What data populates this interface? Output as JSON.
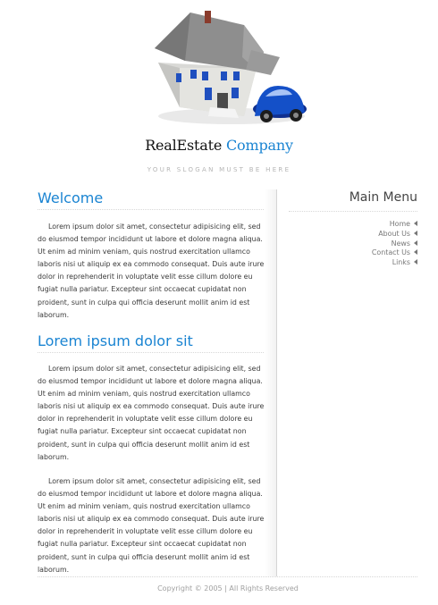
{
  "header": {
    "logo_part1": "RealEstate",
    "logo_part2": "Company",
    "slogan": "YOUR SLOGAN MUST BE HERE",
    "hero_image": "house-and-car-image",
    "colors": {
      "accent": "#1a84d2",
      "dark": "#111111"
    }
  },
  "main": {
    "section1": {
      "title": "Welcome",
      "paragraph": "Lorem ipsum dolor sit amet, consectetur adipisicing elit, sed do eiusmod tempor incididunt ut labore et dolore magna aliqua. Ut enim ad minim veniam, quis nostrud exercitation ullamco laboris nisi ut aliquip ex ea commodo consequat. Duis aute irure dolor in reprehenderit in voluptate velit esse cillum dolore eu fugiat nulla pariatur. Excepteur sint occaecat cupidatat non proident, sunt in culpa qui officia deserunt mollit anim id est laborum."
    },
    "section2": {
      "title": "Lorem ipsum dolor sit",
      "paragraphs": [
        "Lorem ipsum dolor sit amet, consectetur adipisicing elit, sed do eiusmod tempor incididunt ut labore et dolore magna aliqua. Ut enim ad minim veniam, quis nostrud exercitation ullamco laboris nisi ut aliquip ex ea commodo consequat. Duis aute irure dolor in reprehenderit in voluptate velit esse cillum dolore eu fugiat nulla pariatur. Excepteur sint occaecat cupidatat non proident, sunt in culpa qui officia deserunt mollit anim id est laborum.",
        "Lorem ipsum dolor sit amet, consectetur adipisicing elit, sed do eiusmod tempor incididunt ut labore et dolore magna aliqua. Ut enim ad minim veniam, quis nostrud exercitation ullamco laboris nisi ut aliquip ex ea commodo consequat. Duis aute irure dolor in reprehenderit in voluptate velit esse cillum dolore eu fugiat nulla pariatur. Excepteur sint occaecat cupidatat non proident, sunt in culpa qui officia deserunt mollit anim id est laborum."
      ]
    }
  },
  "sidebar": {
    "title": "Main Menu",
    "items": [
      {
        "label": "Home",
        "icon": "left-arrow-icon"
      },
      {
        "label": "About Us",
        "icon": "left-arrow-icon"
      },
      {
        "label": "News",
        "icon": "left-arrow-icon"
      },
      {
        "label": "Contact Us",
        "icon": "left-arrow-icon"
      },
      {
        "label": "Links",
        "icon": "left-arrow-icon"
      }
    ]
  },
  "footer": {
    "copyright": "Copyright © 2005 | All Rights Reserved"
  }
}
